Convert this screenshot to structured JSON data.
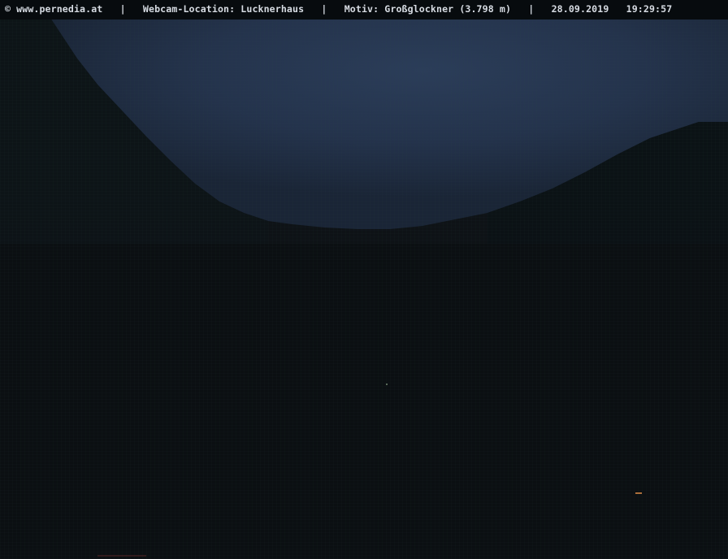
{
  "webcam": {
    "caption": "© www.pernedia.at   |   Webcam-Location: Lucknerhaus   |   Motiv: Großglockner (3.798 m)   |   28.09.2019   19:29:57"
  },
  "colors": {
    "sky_twilight": "#25354f",
    "sky_deep": "#1b2638",
    "mountain_dark": "#0f1518",
    "foreground": "#0a0e11",
    "caption_text": "#d6dbe2"
  }
}
